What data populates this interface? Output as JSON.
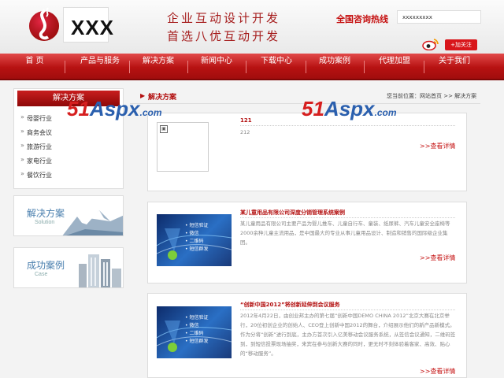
{
  "header": {
    "logo_text": "XXX",
    "slogan_line1": "企业互动设计开发",
    "slogan_line2": "首选八优互动开发",
    "hotline_label": "全国咨询热线",
    "hotline_value": "xxxxxxxxx",
    "follow_label": "+加关注"
  },
  "nav": {
    "items": [
      "首 页",
      "产品与服务",
      "解决方案",
      "新闻中心",
      "下载中心",
      "成功案例",
      "代理加盟",
      "关于我们"
    ]
  },
  "sidebar": {
    "title": "解决方案",
    "items": [
      "母婴行业",
      "商务会议",
      "旅游行业",
      "家电行业",
      "餐饮行业"
    ],
    "banners": [
      {
        "title": "解决方案",
        "subtitle": "Solution"
      },
      {
        "title": "成功案例",
        "subtitle": "Case"
      }
    ]
  },
  "main": {
    "title": "解决方案",
    "breadcrumb": "您当前位置：网站首页 >> 解决方案",
    "articles": [
      {
        "title": "121",
        "text": "212",
        "more": ">>查看详情"
      },
      {
        "title": "某儿童用品有限公司深度分销管理系统案例",
        "text": "某儿童用品有限公司主要产品为婴儿推车、儿童自行车、童装、纸尿裤、汽车儿童安全座椅等2000余种儿童主流用品，是中国最大的专业从事儿童用品设计、制造和销售的国际级企业集团。",
        "more": ">>查看详情"
      },
      {
        "title": "“创新中国2012”将创新延伸到会议服务",
        "text": "2012年4月22日，由创业邦主办的第七届“创新中国DEMO CHINA 2012”北京大赛在北京举行，20位初创企业的创始人、CEO登上创新中国2012的舞台，介绍展示他们的新产品新模式。作为分将“创新”进行到底，主办方首次引入亿美移动会议服务系统，从签信会议通知，二维码签到，到短信投票现场抽奖，来宾在参与创新大赛的同时，更无时不刻体验着客家、高效、贴心的“移动服务”。",
        "more": ">>查看详情"
      }
    ],
    "thumb_menu": [
      "• 短信验证",
      "• 微信",
      "• 二维码",
      "• 短信群发"
    ]
  },
  "watermark": {
    "part1": "51",
    "part2": "Aspx",
    "suffix": ".com"
  },
  "colors": {
    "brand_red": "#b31010",
    "nav_red": "#c01616",
    "link_blue": "#2a5fae"
  }
}
